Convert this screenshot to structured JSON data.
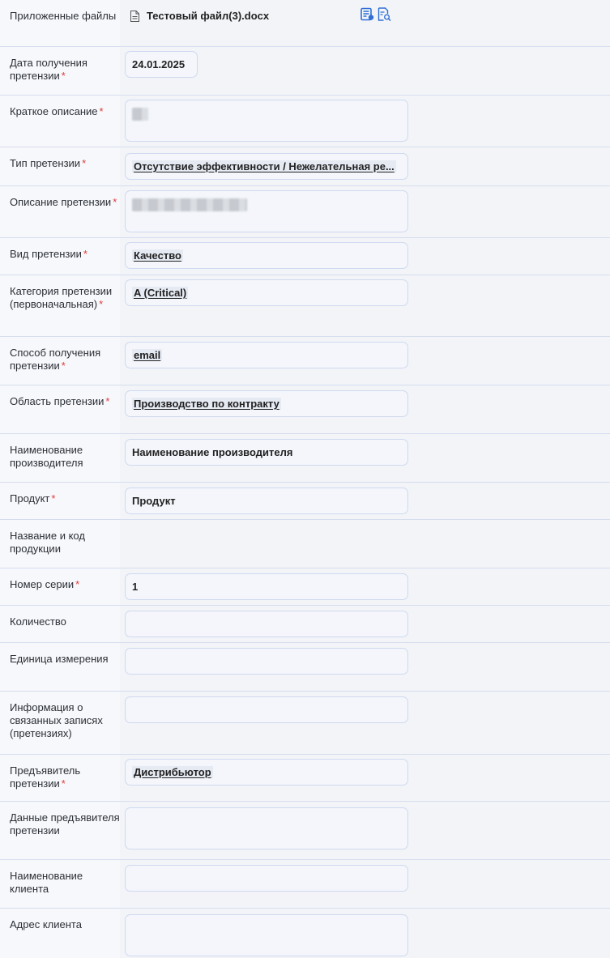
{
  "attachments": {
    "label": "Приложенные файлы",
    "file_name": "Тестовый файл(3).docx",
    "actions": [
      "edit-file-icon",
      "preview-file-icon"
    ]
  },
  "fields": [
    {
      "key": "date",
      "label": "Дата получения претензии",
      "required": true,
      "value": "24.01.2025"
    },
    {
      "key": "short_desc",
      "label": "Краткое описание",
      "required": true,
      "value": ""
    },
    {
      "key": "type",
      "label": "Тип претензии",
      "required": true,
      "value": "Отсутствие эффективности / Нежелательная ре..."
    },
    {
      "key": "desc",
      "label": "Описание претензии",
      "required": true,
      "value": ""
    },
    {
      "key": "kind",
      "label": "Вид претензии",
      "required": true,
      "value": "Качество"
    },
    {
      "key": "category",
      "label": "Категория претензии (первоначальная)",
      "required": true,
      "value": "A (Critical)"
    },
    {
      "key": "method",
      "label": "Способ получения претензии",
      "required": true,
      "value": "email"
    },
    {
      "key": "area",
      "label": "Область претензии",
      "required": true,
      "value": "Производство по контракту"
    },
    {
      "key": "manufacturer",
      "label": "Наименование производителя",
      "required": false,
      "value": "Наименование производителя"
    },
    {
      "key": "product",
      "label": "Продукт",
      "required": true,
      "value": "Продукт"
    },
    {
      "key": "product_code",
      "label": "Название и код продукции",
      "required": false,
      "value": ""
    },
    {
      "key": "batch",
      "label": "Номер серии",
      "required": true,
      "value": "1"
    },
    {
      "key": "quantity",
      "label": "Количество",
      "required": false,
      "value": ""
    },
    {
      "key": "unit",
      "label": "Единица измерения",
      "required": false,
      "value": ""
    },
    {
      "key": "related",
      "label": "Информация о связанных записях (претензиях)",
      "required": false,
      "value": ""
    },
    {
      "key": "claimant",
      "label": "Предъявитель претензии",
      "required": true,
      "value": "Дистрибьютор"
    },
    {
      "key": "claimant_data",
      "label": "Данные предъявителя претензии",
      "required": false,
      "value": ""
    },
    {
      "key": "client_name",
      "label": "Наименование клиента",
      "required": false,
      "value": ""
    },
    {
      "key": "client_address",
      "label": "Адрес клиента",
      "required": false,
      "value": ""
    }
  ],
  "required_mark": "*",
  "colors": {
    "required": "#e23a3a",
    "icon": "#2f6fd6",
    "field_border": "#cfd9ee"
  }
}
